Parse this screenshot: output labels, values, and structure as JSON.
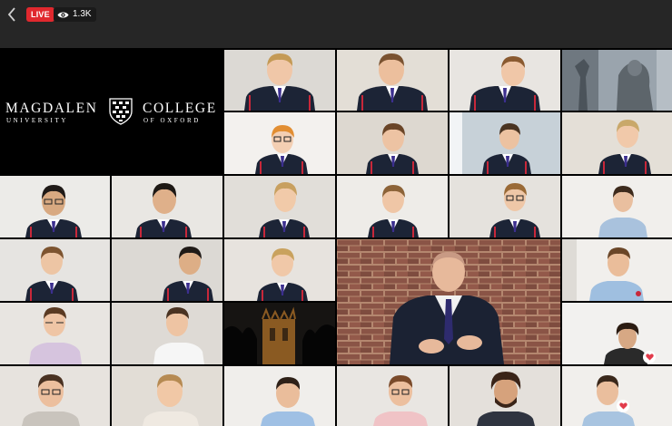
{
  "stream": {
    "live_label": "LIVE",
    "view_count": "1.3K"
  },
  "logo": {
    "left_main": "MAGDALEN",
    "left_sub": "UNIVERSITY",
    "right_main": "COLLEGE",
    "right_sub": "OF OXFORD"
  },
  "icons": {
    "back": "chevron-left-icon",
    "views": "eye-icon",
    "reaction": "heart-icon"
  },
  "colors": {
    "topbar": "#262626",
    "live_badge": "#e0282e",
    "blazer": "#1c2436",
    "blazer_stripe": "#c8283a",
    "brick_wall": "#8a5446",
    "heart": "#e23b4b"
  }
}
